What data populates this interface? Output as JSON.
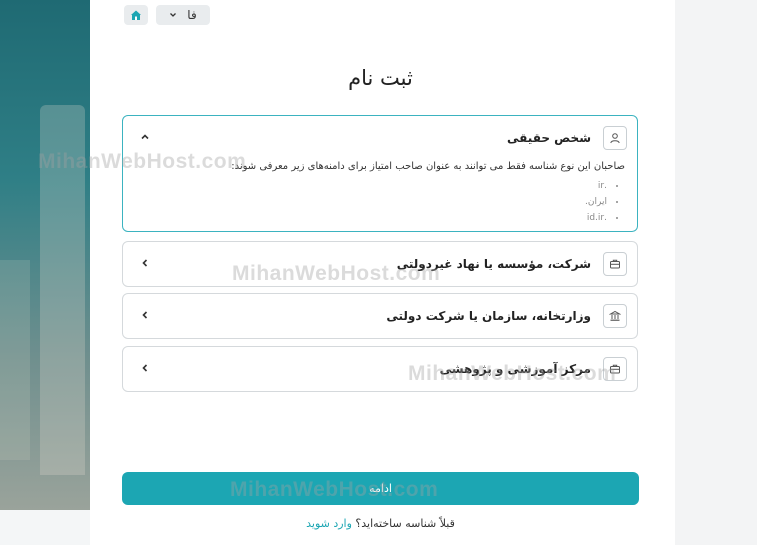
{
  "topbar": {
    "lang_label": "فا",
    "home_icon": "home-icon",
    "lang_icon": "chevron-down-icon"
  },
  "page_title": "ثبت نام",
  "cards": [
    {
      "label": "شخص حقیقی",
      "icon": "user-icon",
      "expanded": true,
      "description": "صاحبان این نوع شناسه فقط می توانند به عنوان صاحب امتیاز برای دامنه‌های زیر معرفی شوند:",
      "domains": [
        ".ir",
        "ایران.",
        ".id.ir"
      ]
    },
    {
      "label": "شرکت، مؤسسه یا نهاد غیردولتی",
      "icon": "briefcase-icon",
      "expanded": false
    },
    {
      "label": "وزارتخانه، سازمان یا شرکت دولتی",
      "icon": "bank-icon",
      "expanded": false
    },
    {
      "label": "مرکز آموزشی و پژوهشی",
      "icon": "briefcase-icon",
      "expanded": false
    }
  ],
  "continue_label": "ادامه",
  "signin": {
    "prompt": "قبلاً شناسه ساخته‌اید؟",
    "link": "وارد شوید"
  },
  "watermark": "MihanWebHost.com",
  "colors": {
    "accent": "#1ca6b3",
    "active_border": "#3bb3c0"
  }
}
